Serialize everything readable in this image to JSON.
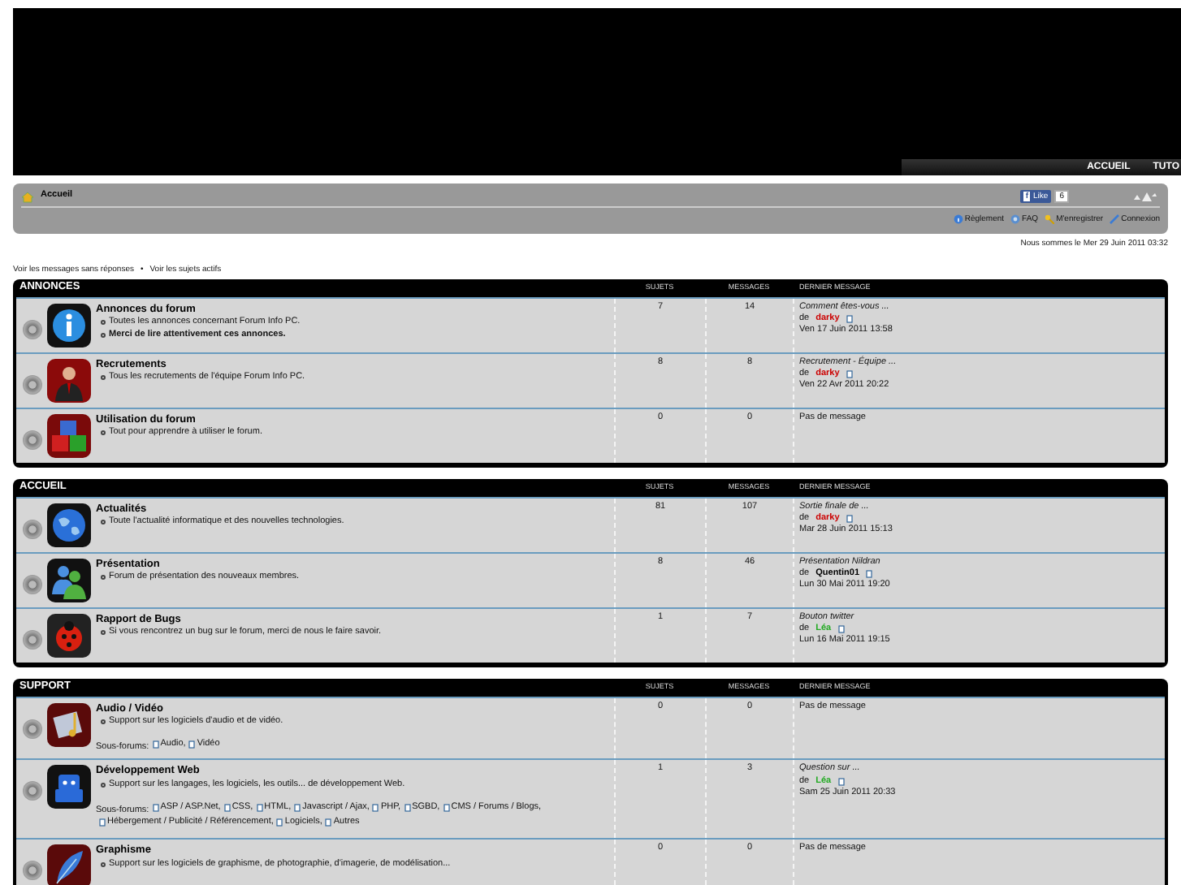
{
  "header": {
    "nav": [
      {
        "label": "ACCUEIL"
      },
      {
        "label": "TUTO"
      }
    ]
  },
  "navbar": {
    "breadcrumb": "Accueil",
    "like_logo": "f",
    "like_button": "Like",
    "like_count": "6",
    "links": [
      {
        "label": "Règlement"
      },
      {
        "label": "FAQ"
      },
      {
        "label": "M'enregistrer"
      },
      {
        "label": "Connexion"
      }
    ]
  },
  "date_line": "Nous sommes le Mer 29 Juin 2011 03:32",
  "quick_links": [
    {
      "label": "Voir les messages sans réponses"
    },
    {
      "label": "Voir les sujets actifs"
    }
  ],
  "quick_separator": "•",
  "categories": [
    {
      "title": "ANNONCES",
      "columns": [
        "SUJETS",
        "MESSAGES",
        "DERNIER MESSAGE"
      ],
      "forums": [
        {
          "title": "Annonces du forum",
          "descriptions": [
            {
              "text": "Toutes les annonces concernant Forum Info PC.",
              "bold": false
            },
            {
              "text": "Merci de lire attentivement ces annonces.",
              "bold": true
            }
          ],
          "topics": "7",
          "posts": "14",
          "last_post": {
            "subject": "Comment êtes-vous ...",
            "by": "de",
            "author": "darky",
            "color": "#cc0000",
            "date": "Ven 17 Juin 2011 13:58"
          }
        },
        {
          "title": "Recrutements",
          "descriptions": [
            {
              "text": "Tous les recrutements de l'équipe Forum Info PC.",
              "bold": false
            }
          ],
          "topics": "8",
          "posts": "8",
          "last_post": {
            "subject": "Recrutement - Équipe ...",
            "by": "de",
            "author": "darky",
            "color": "#cc0000",
            "date": "Ven 22 Avr 2011 20:22"
          }
        },
        {
          "title": "Utilisation du forum",
          "descriptions": [
            {
              "text": "Tout pour apprendre à utiliser le forum.",
              "bold": false
            }
          ],
          "topics": "0",
          "posts": "0",
          "no_post": "Pas de message"
        }
      ]
    },
    {
      "title": "ACCUEIL",
      "columns": [
        "SUJETS",
        "MESSAGES",
        "DERNIER MESSAGE"
      ],
      "forums": [
        {
          "title": "Actualités",
          "descriptions": [
            {
              "text": "Toute l'actualité informatique et des nouvelles technologies.",
              "bold": false
            }
          ],
          "topics": "81",
          "posts": "107",
          "last_post": {
            "subject": "Sortie finale de ...",
            "by": "de",
            "author": "darky",
            "color": "#cc0000",
            "date": "Mar 28 Juin 2011 15:13"
          }
        },
        {
          "title": "Présentation",
          "descriptions": [
            {
              "text": "Forum de présentation des nouveaux membres.",
              "bold": false
            }
          ],
          "topics": "8",
          "posts": "46",
          "last_post": {
            "subject": "Présentation Nildran",
            "by": "de",
            "author": "Quentin01",
            "color": "#000000",
            "date": "Lun 30 Mai 2011 19:20"
          }
        },
        {
          "title": "Rapport de Bugs",
          "descriptions": [
            {
              "text": "Si vous rencontrez un bug sur le forum, merci de nous le faire savoir.",
              "bold": false
            }
          ],
          "topics": "1",
          "posts": "7",
          "last_post": {
            "subject": "Bouton twitter",
            "by": "de",
            "author": "Léa",
            "color": "#22aa22",
            "date": "Lun 16 Mai 2011 19:15"
          }
        }
      ]
    },
    {
      "title": "SUPPORT",
      "columns": [
        "SUJETS",
        "MESSAGES",
        "DERNIER MESSAGE"
      ],
      "forums": [
        {
          "title": "Audio / Vidéo",
          "descriptions": [
            {
              "text": "Support sur les logiciels d'audio et de vidéo.",
              "bold": false
            }
          ],
          "subforums_label": "Sous-forums:",
          "subforums": [
            "Audio,",
            "Vidéo"
          ],
          "topics": "0",
          "posts": "0",
          "no_post": "Pas de message"
        },
        {
          "title": "Développement Web",
          "descriptions": [
            {
              "text": "Support sur les langages, les logiciels, les outils... de développement Web.",
              "bold": false
            }
          ],
          "subforums_label": "Sous-forums:",
          "subforums": [
            "ASP / ASP.Net,",
            "CSS,",
            "HTML,",
            "Javascript / Ajax,",
            "PHP,",
            "SGBD,",
            "CMS / Forums / Blogs,",
            "Hébergement / Publicité / Référencement,",
            "Logiciels,",
            "Autres"
          ],
          "topics": "1",
          "posts": "3",
          "last_post": {
            "subject": "Question sur ...",
            "by": "de",
            "author": "Léa",
            "color": "#22aa22",
            "date": "Sam 25 Juin 2011 20:33"
          }
        },
        {
          "title": "Graphisme",
          "descriptions": [
            {
              "text": "Support sur les logiciels de graphisme, de photographie, d'imagerie, de modélisation...",
              "bold": false
            }
          ],
          "topics": "0",
          "posts": "0",
          "no_post": "Pas de message"
        }
      ]
    }
  ]
}
